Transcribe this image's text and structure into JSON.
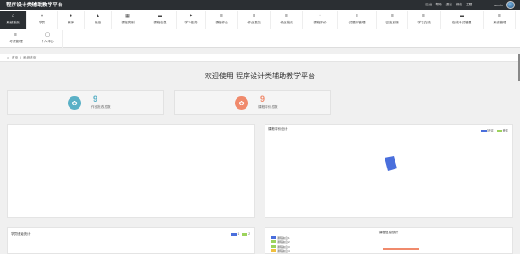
{
  "header": {
    "app_title": "程序设计类辅助教学平台",
    "right_items": [
      "后台",
      "帮助",
      "退出",
      "修改",
      "主题"
    ],
    "user": "admin"
  },
  "nav": {
    "row1": [
      {
        "label": "系统首页",
        "icon": "home-icon",
        "active": true
      },
      {
        "label": "学员",
        "icon": "user-icon"
      },
      {
        "label": "教师",
        "icon": "user-icon"
      },
      {
        "label": "班级",
        "icon": "group-icon"
      },
      {
        "label": "课程类别",
        "icon": "grid-icon"
      },
      {
        "label": "课程信息",
        "icon": "monitor-icon"
      },
      {
        "label": "学习任务",
        "icon": "send-icon"
      },
      {
        "label": "课程作业",
        "icon": "list-icon"
      },
      {
        "label": "作业提交",
        "icon": "list-icon"
      },
      {
        "label": "作业批改",
        "icon": "list-icon"
      },
      {
        "label": "课程评价",
        "icon": "cart-icon"
      },
      {
        "label": "试题库管理",
        "icon": "list-icon"
      },
      {
        "label": "留言反馈",
        "icon": "list-icon"
      },
      {
        "label": "学习交流",
        "icon": "list-icon"
      },
      {
        "label": "在线考试管理",
        "icon": "monitor-icon"
      },
      {
        "label": "系统管理",
        "icon": "list-icon"
      }
    ],
    "row2": [
      {
        "label": "考试管理",
        "icon": "list-icon"
      },
      {
        "label": "个人中心",
        "icon": "user-icon"
      }
    ]
  },
  "breadcrumb": {
    "home": "首页",
    "sep": "/",
    "current": "系统首页"
  },
  "welcome": "欢迎使用 程序设计类辅助教学平台",
  "stats": [
    {
      "value": "9",
      "label": "作业批改总数",
      "color": "#5ab0c6"
    },
    {
      "value": "9",
      "label": "课程评价总数",
      "color": "#f08a6c"
    }
  ],
  "panels": {
    "course_eval_title": "课程评价统计",
    "course_eval_legend": [
      "好评",
      "差评"
    ],
    "class_title": "学员班级统计",
    "class_legend": [
      "1",
      "2"
    ],
    "course_info_title": "课程信息统计",
    "course_info_items": [
      "课程信息1",
      "课程信息2",
      "课程信息3",
      "课程信息4"
    ]
  },
  "colors": {
    "topbar": "#2b2f33",
    "blue": "#4a6fdc",
    "green": "#9cd35c",
    "pie_blue": "#4a6fdc",
    "orange": "#f08a6c",
    "teal": "#5ab0c6"
  }
}
